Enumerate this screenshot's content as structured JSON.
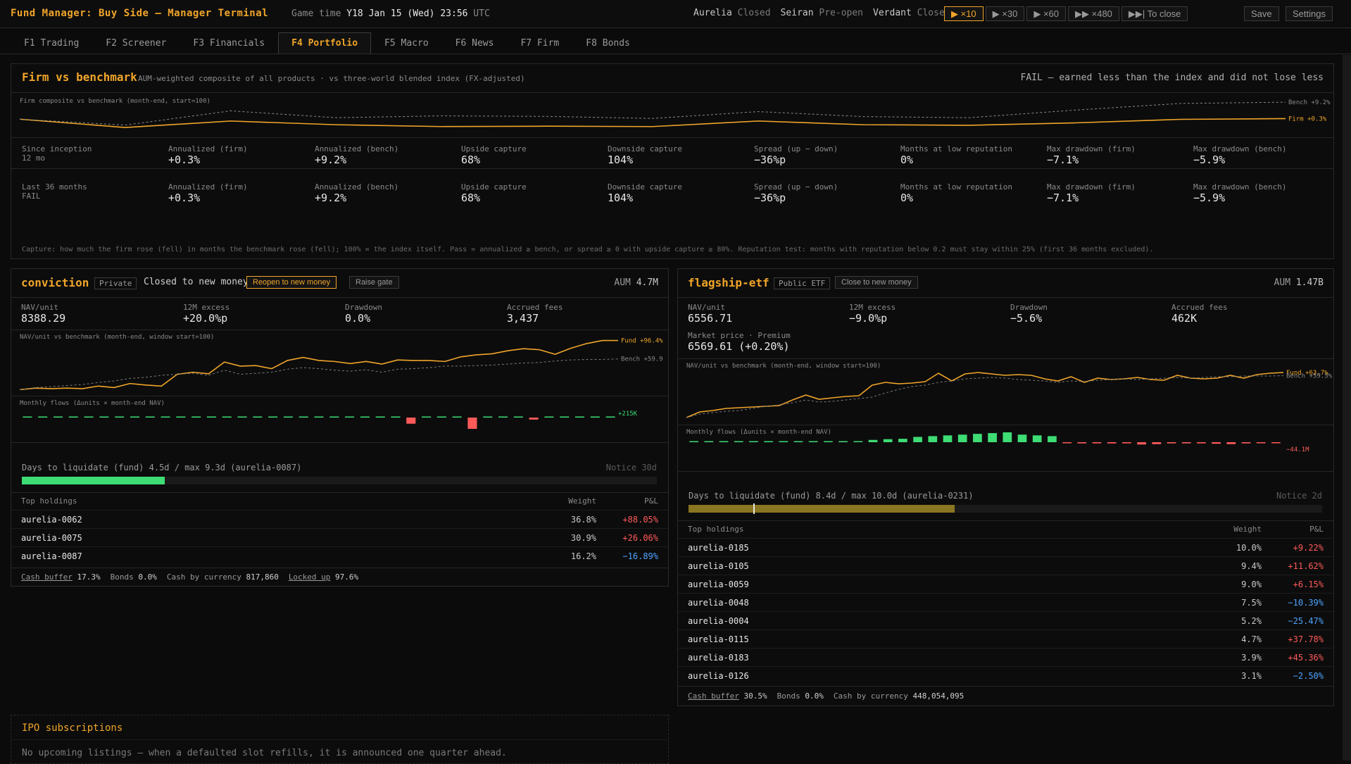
{
  "app": {
    "title": "Fund Manager: Buy Side — Manager Terminal"
  },
  "clock": {
    "label": "Game time",
    "value": "Y18 Jan 15 (Wed) 23:56",
    "tz": "UTC"
  },
  "markets": [
    {
      "name": "Aurelia",
      "status": "Closed"
    },
    {
      "name": "Seiran",
      "status": "Pre-open"
    },
    {
      "name": "Verdant",
      "status": "Closed"
    }
  ],
  "speeds": [
    {
      "label": "▶ ×10",
      "active": true
    },
    {
      "label": "▶ ×30"
    },
    {
      "label": "▶ ×60"
    },
    {
      "label": "▶▶ ×480"
    },
    {
      "label": "▶▶| To close"
    }
  ],
  "actions": {
    "save": "Save",
    "settings": "Settings"
  },
  "tabs": [
    "F1 Trading",
    "F2 Screener",
    "F3 Financials",
    "F4 Portfolio",
    "F5 Macro",
    "F6 News",
    "F7 Firm",
    "F8 Bonds"
  ],
  "active_tab": "F4 Portfolio",
  "firm": {
    "title": "Firm vs benchmark",
    "subtitle": "AUM-weighted composite of all products · vs three-world blended index (FX-adjusted)",
    "verdict": "FAIL — earned less than the index and did not lose less",
    "chart_label": "Firm composite vs benchmark (month-end, start=100)",
    "rows": [
      {
        "head_label": "Since inception",
        "head_value": "12 mo",
        "stats": [
          {
            "label": "Annualized (firm)",
            "value": "+0.3%"
          },
          {
            "label": "Annualized (bench)",
            "value": "+9.2%"
          },
          {
            "label": "Upside capture",
            "value": "68%"
          },
          {
            "label": "Downside capture",
            "value": "104%"
          },
          {
            "label": "Spread (up − down)",
            "value": "−36%p",
            "color": "blue"
          },
          {
            "label": "Months at low reputation",
            "value": "0%",
            "color": "red"
          },
          {
            "label": "Max drawdown (firm)",
            "value": "−7.1%"
          },
          {
            "label": "Max drawdown (bench)",
            "value": "−5.9%"
          }
        ]
      },
      {
        "head_label": "Last 36 months",
        "head_value": "FAIL",
        "stats": [
          {
            "label": "Annualized (firm)",
            "value": "+0.3%"
          },
          {
            "label": "Annualized (bench)",
            "value": "+9.2%"
          },
          {
            "label": "Upside capture",
            "value": "68%"
          },
          {
            "label": "Downside capture",
            "value": "104%"
          },
          {
            "label": "Spread (up − down)",
            "value": "−36%p",
            "color": "blue"
          },
          {
            "label": "Months at low reputation",
            "value": "0%",
            "color": "red"
          },
          {
            "label": "Max drawdown (firm)",
            "value": "−7.1%"
          },
          {
            "label": "Max drawdown (bench)",
            "value": "−5.9%"
          }
        ]
      }
    ],
    "note": "Capture: how much the firm rose (fell) in months the benchmark rose (fell); 100% = the index itself. Pass = annualized ≥ bench, or spread ≥ 0 with upside capture ≥ 80%. Reputation test: months with reputation below 0.2 must stay within 25% (first 36 months excluded)."
  },
  "funds": [
    {
      "id": "conv",
      "name": "conviction",
      "tag": "Private",
      "status_text": "Closed to new money",
      "buttons": [
        "Reopen to new money",
        "Raise gate"
      ],
      "aum_label": "AUM",
      "aum": "4.7M",
      "stats": [
        {
          "label": "NAV/unit",
          "value": "8388.29"
        },
        {
          "label": "12M excess",
          "value": "+20.0%p",
          "color": "red"
        },
        {
          "label": "Drawdown",
          "value": "0.0%",
          "color": "blue"
        },
        {
          "label": "Accrued fees",
          "value": "3,437"
        }
      ],
      "nav_label": "NAV/unit vs benchmark (month-end, window start=100)",
      "flows_label": "Monthly flows (Δunits × month-end NAV)",
      "liq_label": "Days to liquidate (fund) 4.5d / max 9.3d (aurelia-0087)",
      "liq_notice": "Notice 30d",
      "liq_fraction": 0.225,
      "liq_color": "#3ddc74",
      "hold_hdr": [
        "Top holdings",
        "Weight",
        "P&L"
      ],
      "holdings": [
        {
          "t": "aurelia-0062",
          "w": "36.8%",
          "p": "+88.05%",
          "c": "red"
        },
        {
          "t": "aurelia-0075",
          "w": "30.9%",
          "p": "+26.06%",
          "c": "red"
        },
        {
          "t": "aurelia-0087",
          "w": "16.2%",
          "p": "−16.89%",
          "c": "blue"
        }
      ],
      "footer": [
        {
          "label": "Cash buffer",
          "value": "17.3%",
          "u": true
        },
        {
          "label": "Bonds",
          "value": "0.0%"
        },
        {
          "label": "Cash by currency",
          "value": "817,860"
        },
        {
          "label": "Locked up",
          "value": "97.6%",
          "u": true
        }
      ]
    },
    {
      "id": "flag",
      "name": "flagship-etf",
      "tag": "Public ETF",
      "buttons": [
        "Close to new money"
      ],
      "aum_label": "AUM",
      "aum": "1.47B",
      "stats": [
        {
          "label": "NAV/unit",
          "value": "6556.71"
        },
        {
          "label": "12M excess",
          "value": "−9.0%p",
          "color": "blue"
        },
        {
          "label": "Drawdown",
          "value": "−5.6%",
          "color": "blue"
        },
        {
          "label": "Accrued fees",
          "value": "462K"
        }
      ],
      "market": {
        "label": "Market price · Premium",
        "value": "6569.61 (+0.20%)"
      },
      "nav_label": "NAV/unit vs benchmark (month-end, window start=100)",
      "flows_label": "Monthly flows (Δunits × month-end NAV)",
      "liq_label": "Days to liquidate (fund) 8.4d / max 10.0d (aurelia-0231)",
      "liq_notice": "Notice 2d",
      "liq_fraction": 0.42,
      "liq_color": "#8a7520",
      "hold_hdr": [
        "Top holdings",
        "Weight",
        "P&L"
      ],
      "holdings": [
        {
          "t": "aurelia-0185",
          "w": "10.0%",
          "p": "+9.22%",
          "c": "red"
        },
        {
          "t": "aurelia-0105",
          "w": "9.4%",
          "p": "+11.62%",
          "c": "red"
        },
        {
          "t": "aurelia-0059",
          "w": "9.0%",
          "p": "+6.15%",
          "c": "red"
        },
        {
          "t": "aurelia-0048",
          "w": "7.5%",
          "p": "−10.39%",
          "c": "blue"
        },
        {
          "t": "aurelia-0004",
          "w": "5.2%",
          "p": "−25.47%",
          "c": "blue"
        },
        {
          "t": "aurelia-0115",
          "w": "4.7%",
          "p": "+37.78%",
          "c": "red"
        },
        {
          "t": "aurelia-0183",
          "w": "3.9%",
          "p": "+45.36%",
          "c": "red"
        },
        {
          "t": "aurelia-0126",
          "w": "3.1%",
          "p": "−2.50%",
          "c": "blue"
        }
      ],
      "footer": [
        {
          "label": "Cash buffer",
          "value": "30.5%",
          "u": true
        },
        {
          "label": "Bonds",
          "value": "0.0%"
        },
        {
          "label": "Cash by currency",
          "value": "448,054,095"
        }
      ]
    }
  ],
  "ipo": {
    "title": "IPO subscriptions",
    "message": "No upcoming listings — when a defaulted slot refills, it is announced one quarter ahead."
  },
  "chart_data": [
    {
      "id": "firm-composite",
      "type": "line",
      "title": "Firm composite vs benchmark (month-end, start=100)",
      "x": [
        0,
        1,
        2,
        3,
        4,
        5,
        6,
        7,
        8,
        9,
        10,
        11,
        12
      ],
      "series": [
        {
          "name": "Firm",
          "end_label": "Firm +0.3%",
          "color": "#f0a52a",
          "dashed": false,
          "values": [
            100,
            95.5,
            99,
            97,
            96,
            96.2,
            96,
            99,
            97,
            96.7,
            98,
            99.9,
            100.3
          ]
        },
        {
          "name": "Bench",
          "end_label": "Bench +9.2%",
          "color": "#8a8a8a",
          "dashed": true,
          "values": [
            100,
            96.8,
            104.5,
            100.8,
            101.8,
            101.5,
            100.4,
            104.1,
            101.4,
            100.8,
            104.9,
            108.5,
            109.2
          ]
        }
      ],
      "ylim": [
        94,
        110
      ]
    },
    {
      "id": "conv-nav",
      "type": "line",
      "title": "NAV/unit vs benchmark (month-end, window start=100)",
      "series": [
        {
          "name": "Fund",
          "end_label": "Fund +96.4%",
          "color": "#f0a52a",
          "dashed": false,
          "values": [
            100,
            103,
            102,
            103,
            102,
            107,
            104,
            112,
            109,
            107,
            130,
            134,
            131,
            154,
            146,
            147,
            141,
            157,
            163,
            157,
            155,
            151,
            155,
            150,
            158,
            157,
            157,
            155,
            164,
            168,
            170,
            176,
            180,
            178,
            169,
            181,
            190,
            196,
            196
          ]
        },
        {
          "name": "Bench",
          "end_label": "Bench +59.9",
          "color": "#7a7a7a",
          "dashed": true,
          "values": [
            100,
            104,
            106,
            108,
            110,
            114,
            117,
            122,
            124,
            128,
            130,
            132,
            128,
            138,
            130,
            132,
            134,
            140,
            143,
            141,
            138,
            136,
            139,
            134,
            140,
            141,
            143,
            146,
            146,
            147,
            148,
            150,
            152,
            153,
            156,
            158,
            159,
            159,
            160
          ]
        }
      ],
      "ylim": [
        95,
        205
      ]
    },
    {
      "id": "conv-flows",
      "type": "bar",
      "title": "Monthly flows (Δunits × month-end NAV)",
      "annotation": "+215K",
      "values": [
        0,
        0,
        0,
        0,
        0,
        0,
        0,
        0,
        0,
        0,
        0,
        0,
        0,
        0.05,
        0.08,
        0.1,
        0.15,
        0.2,
        0.08,
        0,
        0,
        0,
        0,
        0,
        0,
        -1.2,
        0,
        0,
        0,
        -2.2,
        0,
        0,
        0,
        -0.4,
        0,
        0,
        0,
        0,
        0
      ],
      "colors": {
        "positive": "#3ddc74",
        "negative": "#ff5a5a"
      }
    },
    {
      "id": "flag-nav",
      "type": "line",
      "title": "NAV/unit vs benchmark (month-end, window start=100)",
      "series": [
        {
          "name": "Fund",
          "end_label": "Fund +63.7%",
          "color": "#f0a52a",
          "dashed": false,
          "values": [
            100,
            108,
            110,
            113,
            114,
            115,
            116,
            117,
            125,
            132,
            126,
            128,
            130,
            131,
            146,
            150,
            148,
            149,
            151,
            163,
            152,
            162,
            164,
            162,
            160,
            161,
            160,
            155,
            152,
            158,
            150,
            156,
            154,
            155,
            157,
            154,
            153,
            160,
            156,
            155,
            156,
            160,
            156,
            161,
            163,
            164
          ]
        },
        {
          "name": "Bench",
          "end_label": "Bench +59.5%",
          "color": "#7a7a7a",
          "dashed": true,
          "values": [
            100,
            105,
            107,
            109,
            110,
            113,
            116,
            118,
            121,
            125,
            122,
            123,
            125,
            127,
            129,
            135,
            140,
            144,
            146,
            150,
            152,
            155,
            156,
            157,
            156,
            154,
            153,
            152,
            150,
            152,
            151,
            153,
            154,
            155,
            154,
            155,
            156,
            157,
            156,
            157,
            158,
            158,
            159,
            159,
            159,
            159.5
          ]
        }
      ],
      "ylim": [
        95,
        175
      ]
    },
    {
      "id": "flag-flows",
      "type": "bar",
      "title": "Monthly flows (Δunits × month-end NAV)",
      "annotation": "−44.1M",
      "values": [
        0,
        0,
        0,
        0,
        0,
        0,
        0,
        0,
        0,
        0,
        0,
        0,
        3,
        4,
        4.5,
        7,
        8,
        9,
        10,
        11,
        12,
        13,
        10,
        9,
        8,
        -1,
        -1.5,
        -1.5,
        -1.6,
        -1.5,
        -3,
        -2.5,
        -1.5,
        -1.5,
        -1.5,
        -2,
        -2.5,
        -1.5,
        -1,
        -0.5
      ],
      "colors": {
        "positive": "#3ddc74",
        "negative": "#ff5a5a"
      }
    }
  ]
}
